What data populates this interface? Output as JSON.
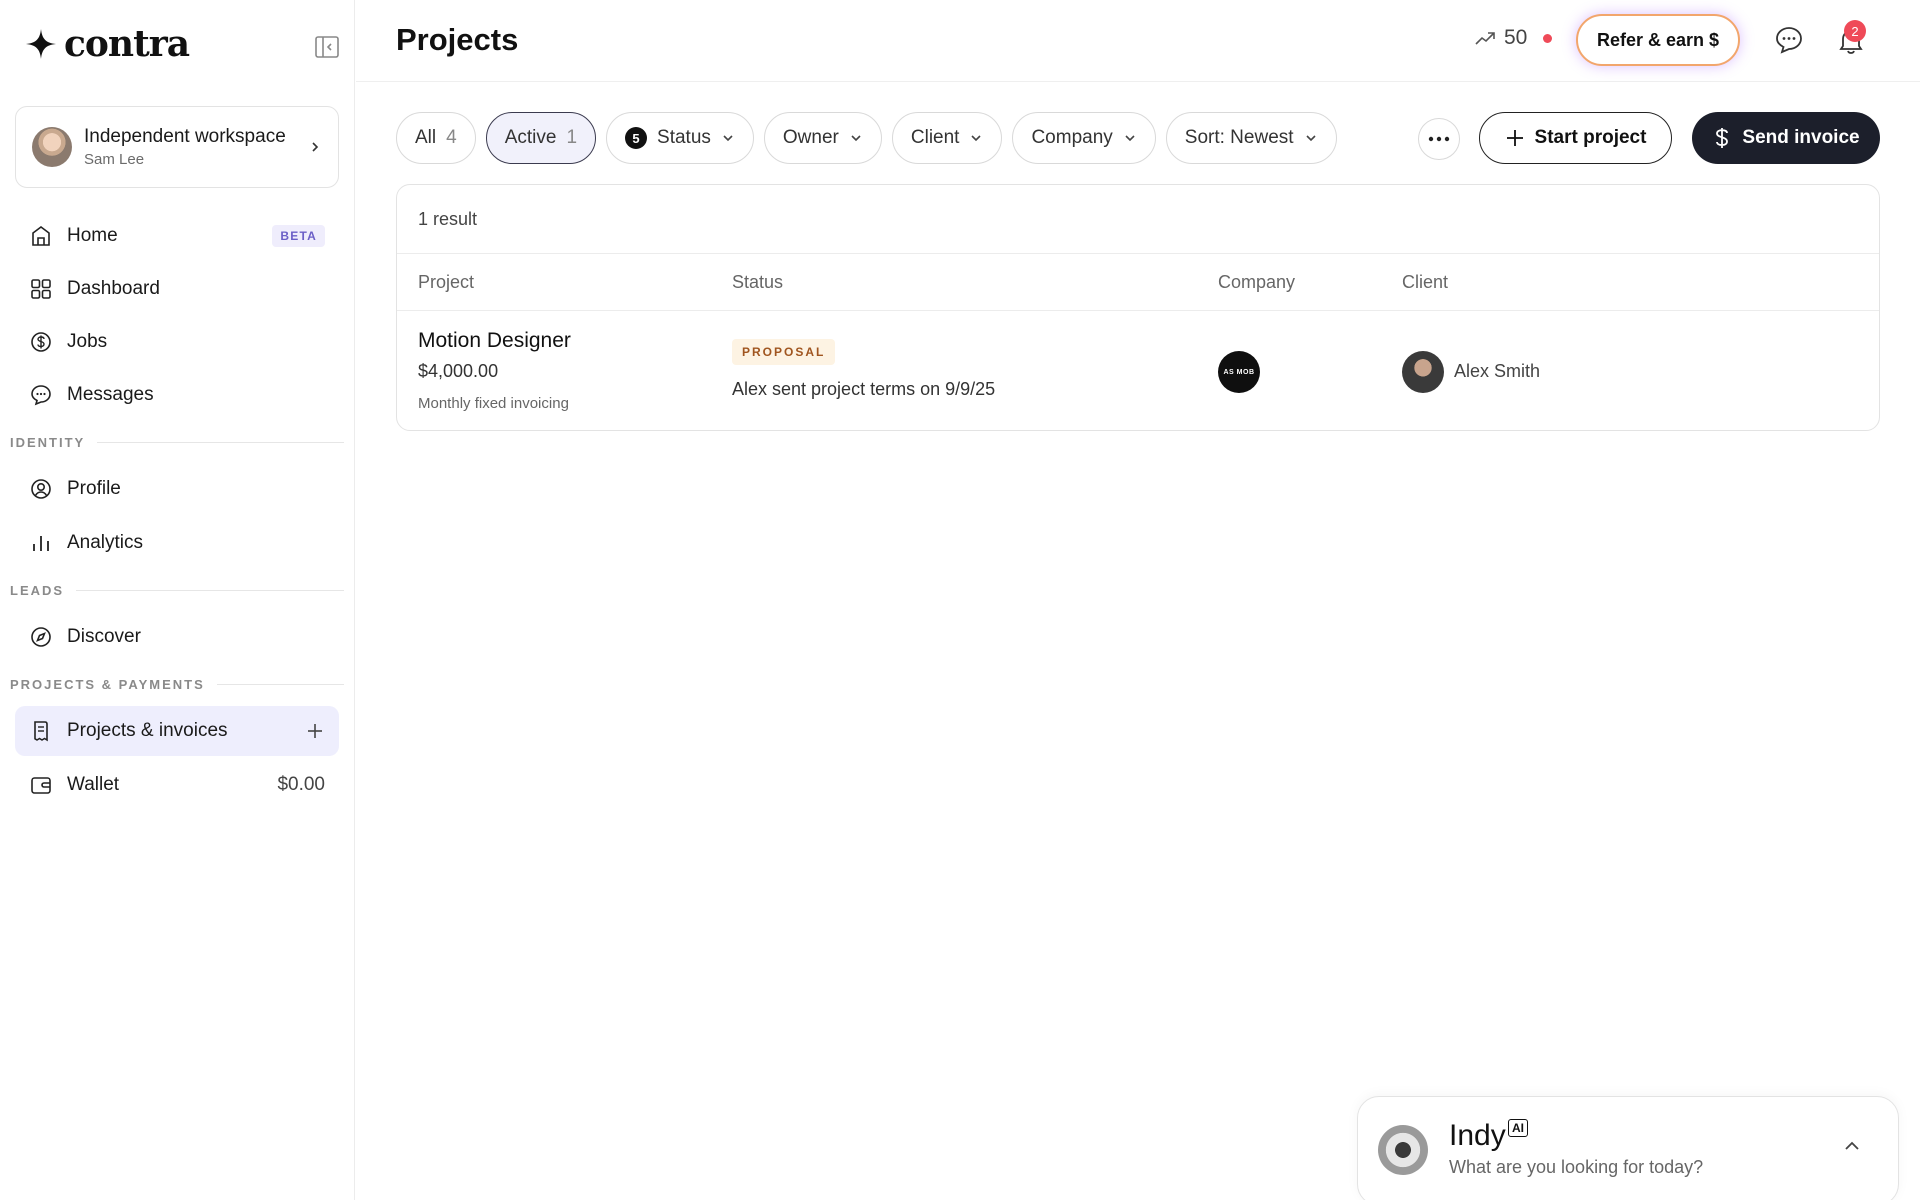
{
  "brand": {
    "name": "contra"
  },
  "workspace": {
    "title": "Independent workspace",
    "user": "Sam Lee"
  },
  "nav": {
    "home": {
      "label": "Home",
      "badge": "BETA"
    },
    "dashboard": {
      "label": "Dashboard"
    },
    "jobs": {
      "label": "Jobs"
    },
    "messages": {
      "label": "Messages"
    },
    "section_identity": "IDENTITY",
    "profile": {
      "label": "Profile"
    },
    "analytics": {
      "label": "Analytics"
    },
    "section_leads": "LEADS",
    "discover": {
      "label": "Discover"
    },
    "section_projects": "PROJECTS & PAYMENTS",
    "projects": {
      "label": "Projects & invoices"
    },
    "wallet": {
      "label": "Wallet",
      "amount": "$0.00"
    }
  },
  "header": {
    "title": "Projects",
    "score": "50",
    "refer_label": "Refer & earn $",
    "notification_count": "2"
  },
  "filters": {
    "all": {
      "label": "All",
      "count": "4"
    },
    "active": {
      "label": "Active",
      "count": "1"
    },
    "status": {
      "label": "Status",
      "count": "5"
    },
    "owner": {
      "label": "Owner"
    },
    "client": {
      "label": "Client"
    },
    "company": {
      "label": "Company"
    },
    "sort": {
      "label": "Sort: Newest"
    },
    "start_label": "Start project",
    "send_label": "Send invoice"
  },
  "table": {
    "result_count": "1 result",
    "columns": [
      "Project",
      "Status",
      "Company",
      "Client"
    ],
    "rows": [
      {
        "project": "Motion Designer",
        "amount": "$4,000.00",
        "invoicing": "Monthly fixed invoicing",
        "status_badge": "PROPOSAL",
        "status_text": "Alex sent project terms on 9/9/25",
        "company_logo_text": "AS MOB",
        "client": "Alex Smith"
      }
    ]
  },
  "indy": {
    "name": "Indy",
    "tag": "AI",
    "prompt": "What are you looking for today?"
  },
  "colors": {
    "accent_dark": "#1c1f2b",
    "active_nav_bg": "#eeeefd",
    "alert_red": "#ef4a58",
    "proposal_text": "#a0551f",
    "proposal_bg": "#fdf3e3"
  }
}
